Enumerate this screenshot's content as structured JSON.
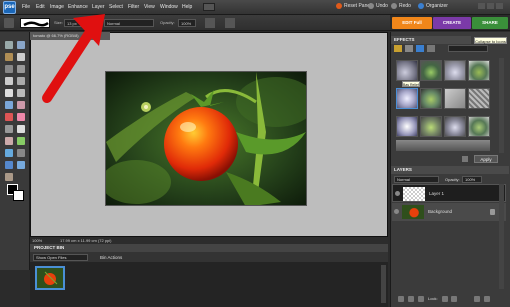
{
  "app": {
    "logo_text": "pse"
  },
  "menu": [
    "File",
    "Edit",
    "Image",
    "Enhance",
    "Layer",
    "Select",
    "Filter",
    "View",
    "Window",
    "Help"
  ],
  "top_actions": {
    "reset_panels": "Reset Panels",
    "undo": "Undo",
    "redo": "Redo",
    "organizer": "Organizer"
  },
  "mode_tabs": {
    "edit_full": "EDIT Full",
    "create": "CREATE",
    "share": "SHARE"
  },
  "options_bar": {
    "size_label": "Size:",
    "size_value": "13 px",
    "mode_label": "Mode:",
    "mode_value": "Normal",
    "opacity_label": "Opacity:",
    "opacity_value": "100%"
  },
  "document_tab": "tomato @ 66.7% (RGB/8)",
  "status": {
    "zoom": "100%",
    "doc_size": "17.99 cm x 11.99 cm (72 ppi)"
  },
  "project_bin": {
    "title": "PROJECT BIN",
    "show_select": "Show Open Files",
    "bin_actions": "Bin Actions"
  },
  "tooltip_collapse": "Collapse to Icons",
  "effects": {
    "title": "EFFECTS",
    "tooltip": "Bas Relief",
    "apply": "Apply"
  },
  "layers": {
    "title": "LAYERS",
    "blend_mode": "Normal",
    "opacity_label": "Opacity:",
    "opacity_value": "100%",
    "lock_label": "Lock:",
    "rows": [
      {
        "name": "Layer 1",
        "selected": true
      },
      {
        "name": "Background",
        "selected": false
      }
    ]
  },
  "colors": {
    "edit_tab": "#f0861a",
    "create_tab": "#7b3aa8",
    "share_tab": "#3a8f3a",
    "accent": "#4a8fd6",
    "arrow": "#e01010"
  }
}
